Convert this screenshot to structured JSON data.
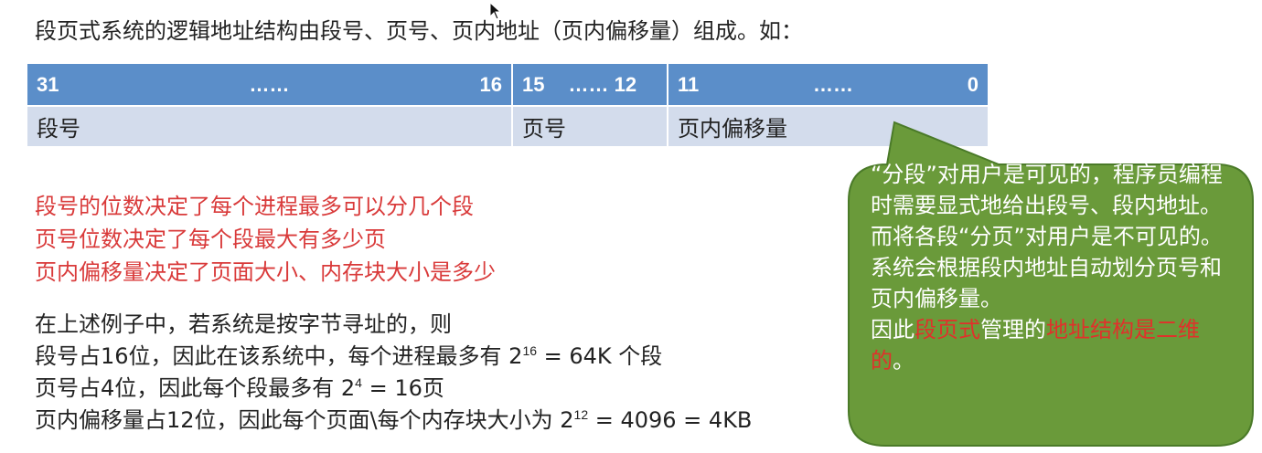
{
  "intro": "段页式系统的逻辑地址结构由段号、页号、页内地址（页内偏移量）组成。如：",
  "table": {
    "header": [
      {
        "left": "31",
        "mid": "……",
        "right": "16"
      },
      {
        "left": "15",
        "mid": "…… 12",
        "right": ""
      },
      {
        "left": "11",
        "mid": "……",
        "right": "0"
      }
    ],
    "fields": [
      "段号",
      "页号",
      "页内偏移量"
    ]
  },
  "red_lines": [
    "段号的位数决定了每个进程最多可以分几个段",
    "页号位数决定了每个段最大有多少页",
    "页内偏移量决定了页面大小、内存块大小是多少"
  ],
  "example": {
    "line1": "在上述例子中，若系统是按字节寻址的，则",
    "line2_pre": "段号占16位，因此在该系统中，每个进程最多有 2",
    "line2_sup": "16",
    "line2_post": " = 64K 个段",
    "line3_pre": "页号占4位，因此每个段最多有 2",
    "line3_sup": "4",
    "line3_post": " = 16页",
    "line4_pre": "页内偏移量占12位，因此每个页面\\每个内存块大小为 2",
    "line4_sup": "12",
    "line4_post": " = 4096 = 4KB"
  },
  "callout": {
    "para1": "“分段”对用户是可见的，程序员编程时需要显式地给出段号、段内地址。而将各段“分页”对用户是不可见的。系统会根据段内地址自动划分页号和页内偏移量。",
    "p2_a": "因此",
    "p2_b": "段页式",
    "p2_c": "管理的",
    "p2_d": "地址结构是二维的",
    "p2_e": "。",
    "fill": "#6a9a3a",
    "stroke": "#4a7a28",
    "highlight": "#e0312b"
  },
  "colors": {
    "table_header": "#5b8ec9",
    "table_row": "#d3dcec",
    "red_text": "#d93a3a"
  }
}
